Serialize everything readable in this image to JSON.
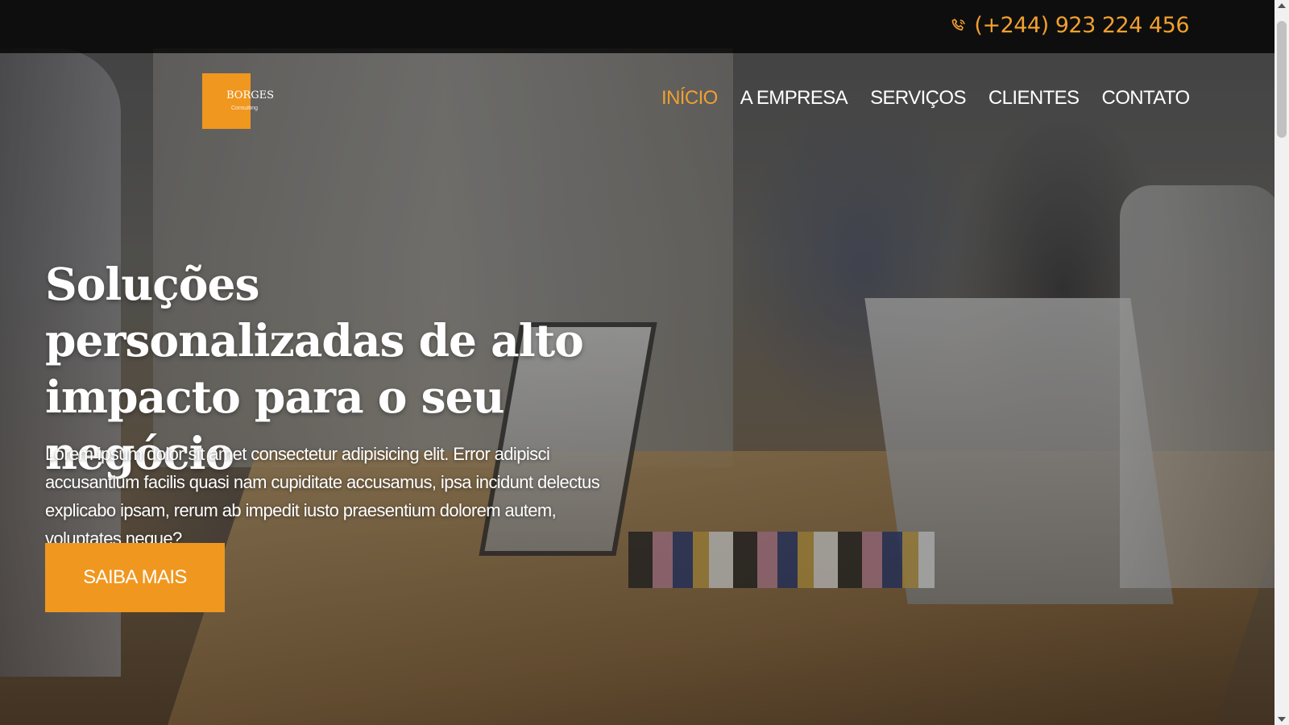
{
  "topbar": {
    "phone_icon": "phone-icon",
    "phone": "(+244) 923 224 456"
  },
  "logo": {
    "name": "BORGES",
    "tagline": "Consulting"
  },
  "nav": {
    "items": [
      {
        "label": "INÍCIO",
        "active": true
      },
      {
        "label": "A EMPRESA",
        "active": false
      },
      {
        "label": "SERVIÇOS",
        "active": false
      },
      {
        "label": "CLIENTES",
        "active": false
      },
      {
        "label": "CONTATO",
        "active": false
      }
    ]
  },
  "hero": {
    "headline": "Soluções personalizadas de alto impacto para o seu negócio",
    "lede": "Lorem ipsum dolor sit amet consectetur adipisicing elit. Error adipisci accusantium facilis quasi nam cupiditate accusamus, ipsa incidunt delectus explicabo ipsam, rerum ab impedit iusto praesentium dolorem autem, voluptates neque?",
    "cta_label": "SAIBA MAIS"
  },
  "colors": {
    "accent": "#f0971f",
    "topbar": "#000000"
  }
}
